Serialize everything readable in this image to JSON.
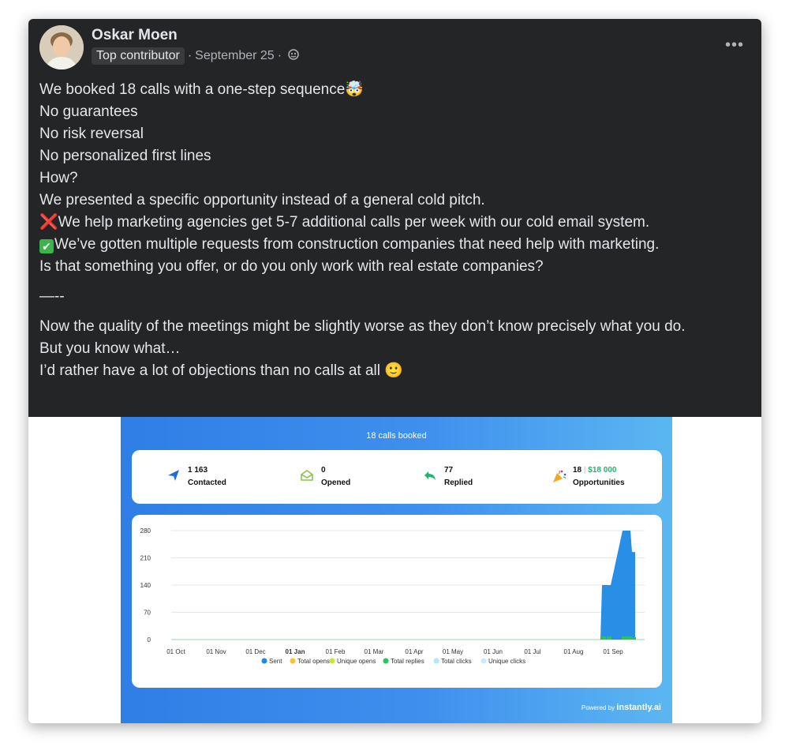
{
  "post": {
    "author": "Oskar Moen",
    "badge": "Top contributor",
    "date": "September 25",
    "more_label": "•••",
    "lines": {
      "l1": "We booked 18 calls with a one-step sequence",
      "l2": "No guarantees",
      "l3": "No risk reversal",
      "l4": "No personalized first lines",
      "l5": "How?",
      "l6": "We presented a specific opportunity instead of a general cold pitch.",
      "l7": "We help marketing agencies get 5-7 additional calls per week with our cold email system.",
      "l8": "We’ve gotten multiple requests from construction companies that need help with marketing.",
      "l9": "Is that something you offer, or do you only work with real estate companies?",
      "l10": "—--",
      "l11": "Now the quality of the meetings might be slightly worse as they don’t know precisely what you do.",
      "l12": "But you know what…",
      "l13": "I’d rather have a lot of objections than no calls at all"
    },
    "emoji": {
      "exploding_head": "🤯",
      "cross": "❌",
      "check": "✔",
      "smile": "🙂"
    }
  },
  "image": {
    "title": "18 calls booked",
    "stats": {
      "contacted": {
        "value": "1 163",
        "label": "Contacted",
        "icon": "send-icon"
      },
      "opened": {
        "value": "0",
        "label": "Opened",
        "icon": "envelope-icon"
      },
      "replied": {
        "value": "77",
        "label": "Replied",
        "icon": "reply-icon"
      },
      "opportunities": {
        "value": "18",
        "divider": "|",
        "amount": "$18 000",
        "label": "Opportunities",
        "icon": "party-icon"
      }
    },
    "powered_prefix": "Powered by",
    "powered_brand": "instantly.ai",
    "colors": {
      "sent": "#1e88e5",
      "total_opens": "#fbc02d",
      "unique_opens": "#c6e63a",
      "total_replies": "#22c55e",
      "total_clicks": "#b3e5fc",
      "unique_clicks": "#cfe8fb"
    }
  },
  "chart_data": {
    "type": "area",
    "x": [
      "01 Oct",
      "01 Nov",
      "01 Dec",
      "01 Jan",
      "01 Feb",
      "01 Mar",
      "01 Apr",
      "01 May",
      "01 Jun",
      "01 Jul",
      "01 Aug",
      "01 Sep"
    ],
    "ylim": [
      0,
      280
    ],
    "yticks": [
      0,
      70,
      140,
      210,
      280
    ],
    "grid": true,
    "legend_position": "bottom",
    "series": [
      {
        "name": "Sent",
        "values": [
          0,
          0,
          0,
          0,
          0,
          0,
          0,
          0,
          0,
          0,
          0,
          0
        ],
        "spikes": [
          140,
          140,
          280,
          280,
          225
        ]
      },
      {
        "name": "Total opens",
        "values": [
          0,
          0,
          0,
          0,
          0,
          0,
          0,
          0,
          0,
          0,
          0,
          0
        ]
      },
      {
        "name": "Unique opens",
        "values": [
          0,
          0,
          0,
          0,
          0,
          0,
          0,
          0,
          0,
          0,
          0,
          0
        ]
      },
      {
        "name": "Total replies",
        "values": [
          0,
          0,
          0,
          0,
          0,
          0,
          0,
          0,
          0,
          0,
          0,
          0
        ],
        "spikes": [
          8,
          8,
          8,
          8,
          6
        ]
      },
      {
        "name": "Total clicks",
        "values": [
          0,
          0,
          0,
          0,
          0,
          0,
          0,
          0,
          0,
          0,
          0,
          0
        ]
      },
      {
        "name": "Unique clicks",
        "values": [
          0,
          0,
          0,
          0,
          0,
          0,
          0,
          0,
          0,
          0,
          0,
          0
        ]
      }
    ]
  }
}
